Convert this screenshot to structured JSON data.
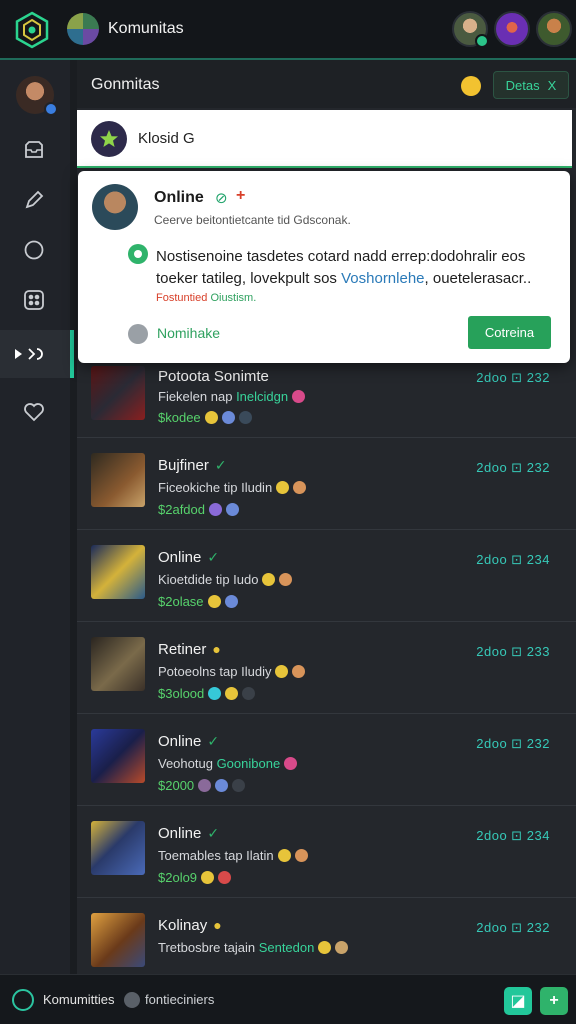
{
  "app": {
    "title": "Komunitas"
  },
  "colors": {
    "accent": "#22c79a",
    "online": "#2fb36b",
    "time": "#36c9b8",
    "link": "#2a7ab8"
  },
  "icons": {
    "logo": "hexagon-logo-icon",
    "server": "server-icon",
    "inbox": "inbox-icon",
    "edit": "pen-icon",
    "circle": "circle-icon",
    "grid": "grid-icon",
    "play": "play-icon",
    "heart": "heart-icon"
  },
  "header": {
    "title": "Gonmitas",
    "button_label": "Detas",
    "button_close": "X"
  },
  "search": {
    "value": "Klosid",
    "suffix": "G"
  },
  "popup": {
    "name": "Online",
    "check": "⊘",
    "plus": "+",
    "subtitle": "Ceerve beitontietcante tid Gdsconak.",
    "message_a": "Nostisenoine tasdetes cotard nadd errep:dodohralir eos toeker tatileg, lovekpult sos",
    "message_link": "Voshornlehe",
    "message_b": ", ouetelerasacr..",
    "meta_red": "Fostuntied",
    "meta_green": "Oiustism.",
    "footer_label": "Nomihake",
    "button_label": "Cotreina"
  },
  "rows": [
    {
      "name": "Potoota Sonimte",
      "badge": "",
      "line2": "Fiekelen nap ",
      "line2_hl": "Inelcidgn",
      "line3": "$kodee",
      "time": "2doo ⊡ 232"
    },
    {
      "name": "Bujfiner",
      "badge": "✓",
      "line2": "Ficeokiche tip Iludin",
      "line2_hl": "",
      "line3": "$2afdod",
      "time": "2doo ⊡ 232"
    },
    {
      "name": "Online",
      "badge": "✓",
      "line2": "Kioetdide tip Iudo",
      "line2_hl": "",
      "line3": "$2olase",
      "time": "2doo ⊡ 234"
    },
    {
      "name": "Retiner",
      "badge": "●",
      "line2": "Potoeolns tap Iludiy",
      "line2_hl": "",
      "line3": "$3olood",
      "time": "2doo ⊡ 233"
    },
    {
      "name": "Online",
      "badge": "✓",
      "line2": "Veohotug ",
      "line2_hl": "Goonibone",
      "line3": "$2000",
      "time": "2doo ⊡ 232"
    },
    {
      "name": "Online",
      "badge": "✓",
      "line2": "Toemables tap Ilatin",
      "line2_hl": "",
      "line3": "$2olo9",
      "time": "2doo ⊡ 234"
    },
    {
      "name": "Kolinay",
      "badge": "●",
      "line2": "Tretbosbre tajain ",
      "line2_hl": "Sentedon",
      "line3": "",
      "time": "2doo ⊡ 232"
    }
  ],
  "bottom": {
    "label_a": "Komumitties",
    "label_b": "fontieciniers",
    "btn_a": "◪",
    "btn_b": "+"
  }
}
